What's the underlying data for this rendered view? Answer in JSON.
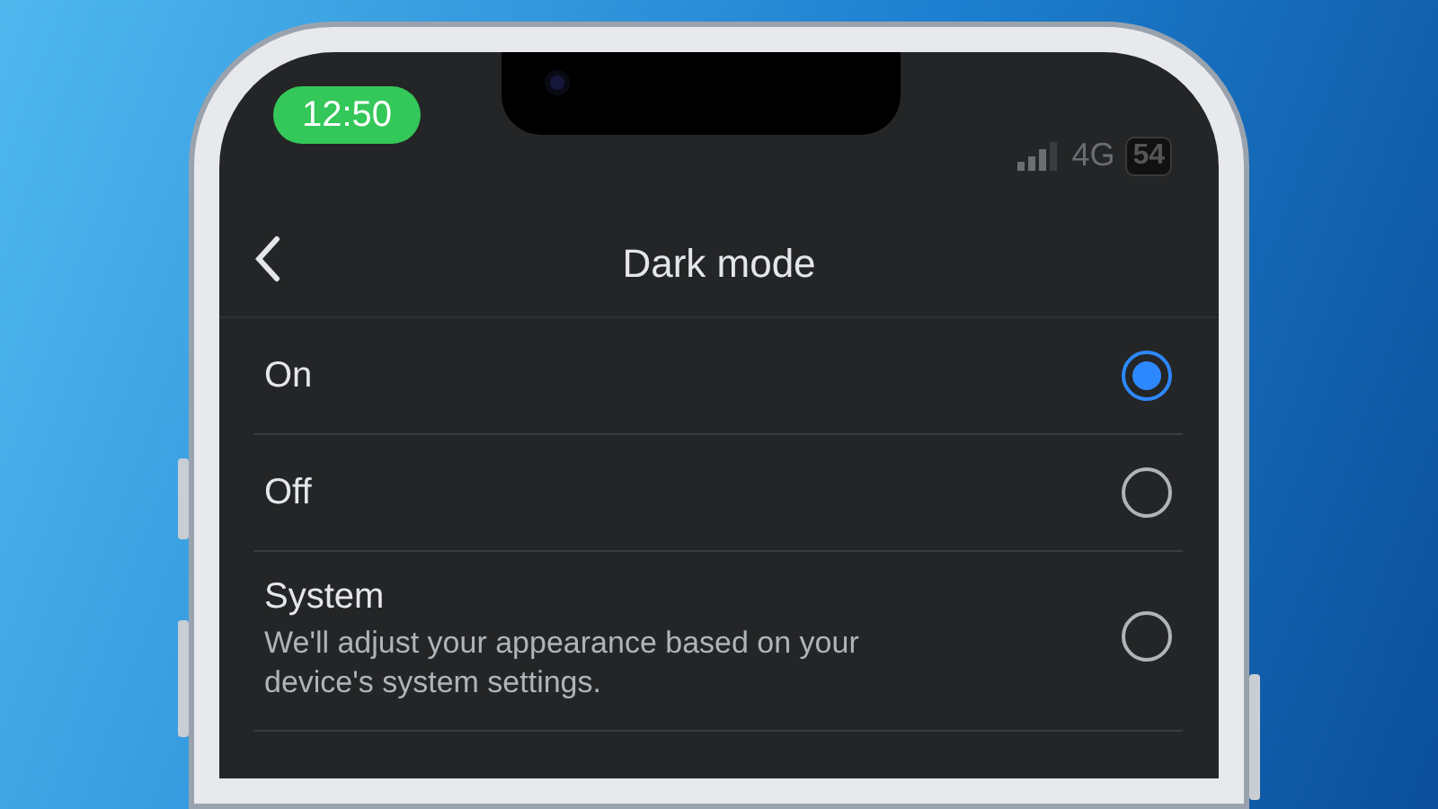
{
  "status_bar": {
    "time": "12:50",
    "network": "4G",
    "battery": "54"
  },
  "header": {
    "title": "Dark mode"
  },
  "options": [
    {
      "label": "On",
      "selected": true
    },
    {
      "label": "Off",
      "selected": false
    },
    {
      "label": "System",
      "description": "We'll adjust your appearance based on your device's system settings.",
      "selected": false
    }
  ]
}
